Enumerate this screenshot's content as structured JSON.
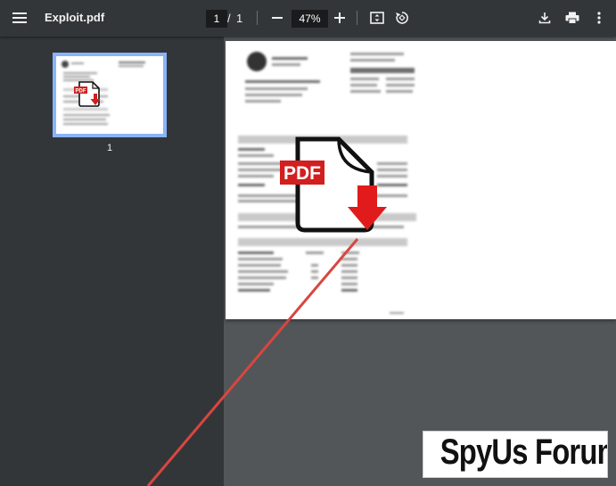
{
  "toolbar": {
    "menu_icon": "hamburger-menu-icon",
    "title": "Exploit.pdf",
    "current_page": "1",
    "page_separator": "/",
    "total_pages": "1",
    "zoom": "47%",
    "zoom_out_icon": "minus-icon",
    "zoom_in_icon": "plus-icon",
    "fit_icon": "fit-to-page-icon",
    "rotate_icon": "rotate-icon",
    "download_icon": "download-icon",
    "print_icon": "print-icon",
    "more_icon": "more-vertical-icon"
  },
  "sidebar": {
    "thumbnails": [
      {
        "page_label": "1",
        "selected": true
      }
    ]
  },
  "overlay": {
    "pdf_badge": "PDF",
    "watermark": "SpyUs Forum",
    "arrow_color": "#d9463f"
  },
  "colors": {
    "toolbar_bg": "#323639",
    "viewer_bg": "#525659",
    "selected_thumb_border": "#8ab4f8",
    "pdf_red": "#d21f1f"
  }
}
